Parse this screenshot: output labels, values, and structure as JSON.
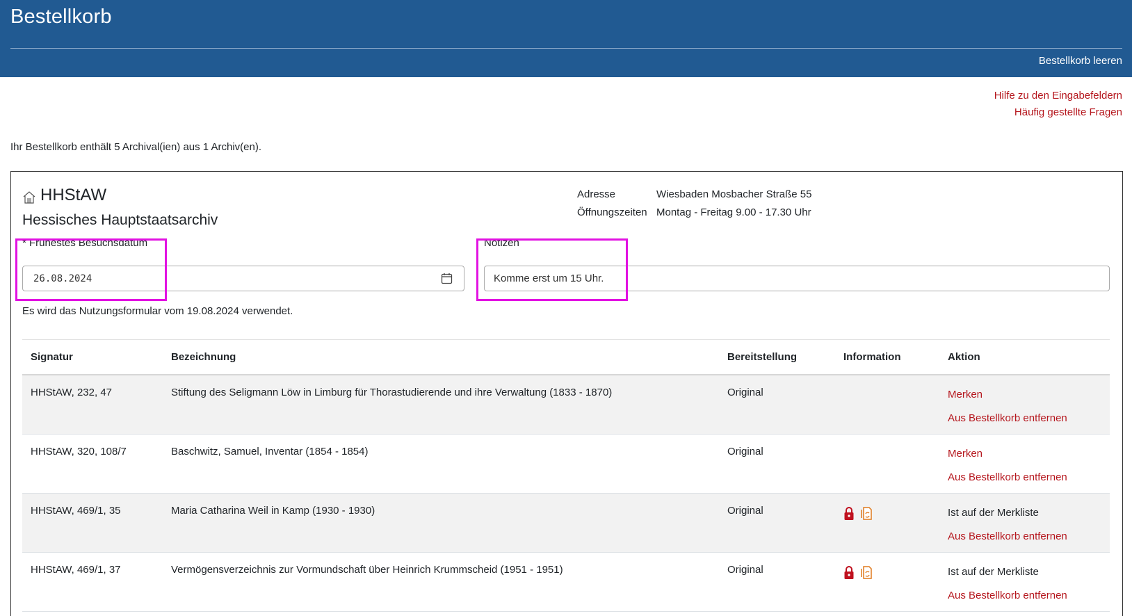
{
  "header": {
    "title": "Bestellkorb",
    "clear_label": "Bestellkorb leeren"
  },
  "help": {
    "fields_help": "Hilfe zu den Eingabefeldern",
    "faq": "Häufig gestellte Fragen"
  },
  "summary": "Ihr Bestellkorb enthält 5 Archival(ien) aus 1 Archiv(en).",
  "archive": {
    "code": "HHStAW",
    "name": "Hessisches Hauptstaatsarchiv",
    "address_label": "Adresse",
    "address_value": "Wiesbaden Mosbacher Straße 55",
    "hours_label": "Öffnungszeiten",
    "hours_value": "Montag - Freitag 9.00 - 17.30 Uhr"
  },
  "form": {
    "date_label": "* Frühestes Besuchsdatum",
    "date_value": "26.08.2024",
    "notes_label": "Notizen",
    "notes_value": "Komme erst um 15 Uhr.",
    "usage_note": "Es wird das Nutzungsformular vom 19.08.2024 verwendet."
  },
  "table": {
    "headers": [
      "Signatur",
      "Bezeichnung",
      "Bereitstellung",
      "Information",
      "Aktion"
    ],
    "rows": [
      {
        "signatur": "HHStAW, 232, 47",
        "bezeichnung": "Stiftung des Seligmann Löw in Limburg für Thorastudierende und ihre Verwaltung (1833 - 1870)",
        "bereitstellung": "Original",
        "info_icons": false,
        "action1": "Merken",
        "action1_link": true,
        "action2": "Aus Bestellkorb entfernen"
      },
      {
        "signatur": "HHStAW, 320, 108/7",
        "bezeichnung": "Baschwitz, Samuel, Inventar (1854 - 1854)",
        "bereitstellung": "Original",
        "info_icons": false,
        "action1": "Merken",
        "action1_link": true,
        "action2": "Aus Bestellkorb entfernen"
      },
      {
        "signatur": "HHStAW, 469/1, 35",
        "bezeichnung": "Maria Catharina Weil in Kamp (1930 - 1930)",
        "bereitstellung": "Original",
        "info_icons": true,
        "action1": "Ist auf der Merkliste",
        "action1_link": false,
        "action2": "Aus Bestellkorb entfernen"
      },
      {
        "signatur": "HHStAW, 469/1, 37",
        "bezeichnung": "Vermögensverzeichnis zur Vormundschaft über Heinrich Krummscheid (1951 - 1951)",
        "bereitstellung": "Original",
        "info_icons": true,
        "action1": "Ist auf der Merkliste",
        "action1_link": false,
        "action2": "Aus Bestellkorb entfernen"
      }
    ]
  },
  "icons": {
    "archive": "house-icon",
    "calendar": "calendar-icon",
    "restricted": "lock-icon",
    "reproduction": "document-copy-icon"
  },
  "colors": {
    "header_bg": "#215a92",
    "link": "#b5161d",
    "highlight": "#e212e2",
    "lock": "#c0111f",
    "copy": "#e07a1e"
  }
}
